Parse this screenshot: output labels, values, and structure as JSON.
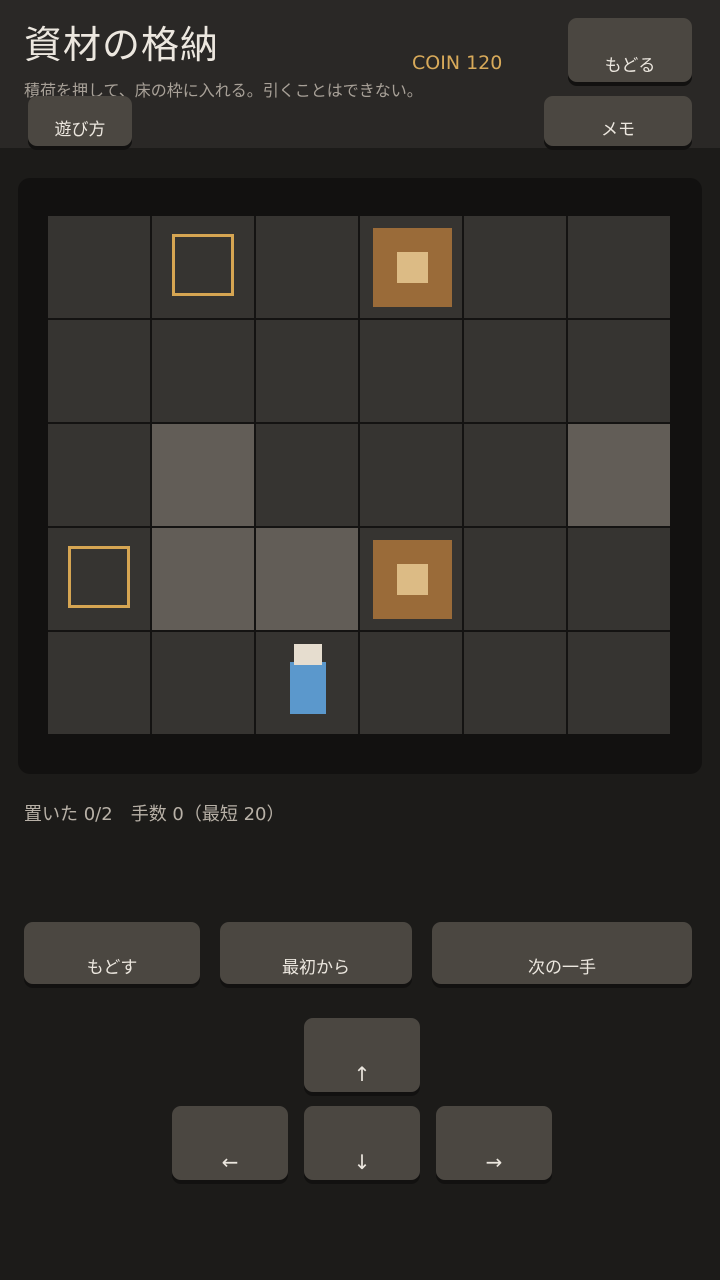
{
  "header": {
    "title": "資材の格納",
    "subtitle": "積荷を押して、床の枠に入れる。引くことはできない。",
    "coin": "COIN 120",
    "back_label": "もどる",
    "howto_label": "遊び方",
    "memo_label": "メモ"
  },
  "status": {
    "text": "置いた 0/2　手数 0（最短 20）",
    "placed": 0,
    "target": 2,
    "moves": 0,
    "best": 20
  },
  "board": {
    "rows": 5,
    "cols": 6,
    "cells": [
      [
        "floor",
        "goal",
        "floor",
        "crate",
        "floor",
        "floor"
      ],
      [
        "floor",
        "floor",
        "floor",
        "floor",
        "floor",
        "floor"
      ],
      [
        "floor",
        "raised",
        "floor",
        "floor",
        "floor",
        "raised"
      ],
      [
        "goal",
        "raised",
        "raised",
        "crate",
        "floor",
        "floor"
      ],
      [
        "floor",
        "floor",
        "player",
        "floor",
        "floor",
        "floor"
      ]
    ]
  },
  "controls": {
    "undo_label": "もどす",
    "restart_label": "最初から",
    "hint_label": "次の一手",
    "up_label": "↑",
    "left_label": "←",
    "down_label": "↓",
    "right_label": "→"
  },
  "colors": {
    "background": "#1c1b19",
    "coin": "#d8aa5a",
    "goal_outline": "#d6a552",
    "crate": "#9a6b39",
    "player": "#5b98cc"
  }
}
